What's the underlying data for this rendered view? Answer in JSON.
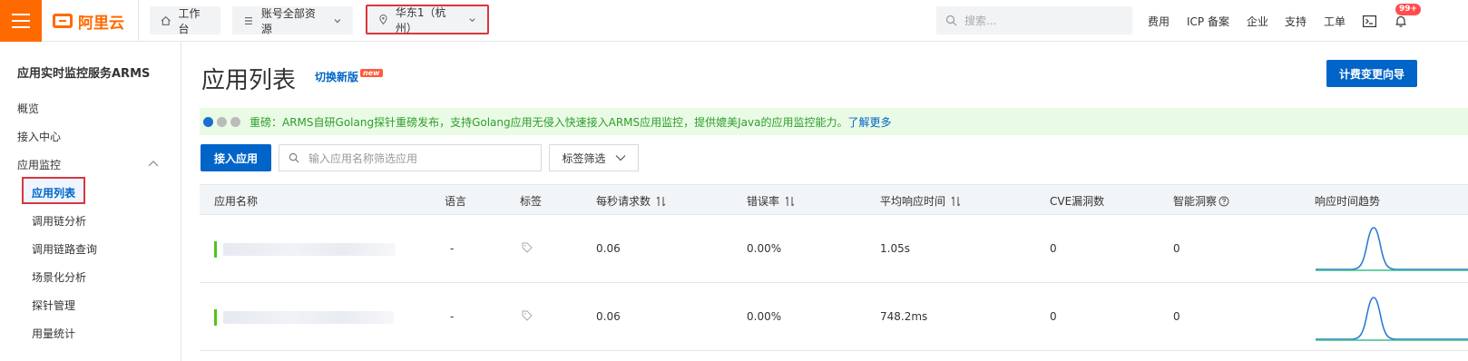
{
  "topbar": {
    "logo_text": "阿里云",
    "workbench": "工作台",
    "resources": "账号全部资源",
    "region": "华东1（杭州）",
    "search_placeholder": "搜索...",
    "nav": [
      "费用",
      "ICP 备案",
      "企业",
      "支持",
      "工单"
    ],
    "notification_badge": "99+"
  },
  "sidebar": {
    "title": "应用实时监控服务ARMS",
    "items": [
      "概览",
      "接入中心",
      "应用监控"
    ],
    "sub_items": [
      "应用列表",
      "调用链分析",
      "调用链路查询",
      "场景化分析",
      "探针管理",
      "用量统计"
    ],
    "active": "应用列表"
  },
  "main": {
    "title": "应用列表",
    "switch_label": "切换新版",
    "new_badge": "new",
    "guide_button": "计费变更向导",
    "banner_text": "重磅：ARMS自研Golang探针重磅发布，支持Golang应用无侵入快速接入ARMS应用监控，提供媲美Java的应用监控能力。",
    "banner_link": "了解更多",
    "add_button": "接入应用",
    "filter_placeholder": "输入应用名称筛选应用",
    "tag_filter": "标签筛选"
  },
  "table": {
    "columns": [
      "应用名称",
      "语言",
      "标签",
      "每秒请求数",
      "错误率",
      "平均响应时间",
      "CVE漏洞数",
      "智能洞察",
      "响应时间趋势"
    ],
    "rows": [
      {
        "language": "-",
        "rps": "0.06",
        "error_rate": "0.00%",
        "avg_rt": "1.05s",
        "cve": "0",
        "insight": "0"
      },
      {
        "language": "-",
        "rps": "0.06",
        "error_rate": "0.00%",
        "avg_rt": "748.2ms",
        "cve": "0",
        "insight": "0"
      }
    ]
  },
  "colors": {
    "brand": "#ff6a00",
    "primary": "#0064c8",
    "highlight_border": "#d9363e",
    "banner_bg": "#eafbe5"
  }
}
